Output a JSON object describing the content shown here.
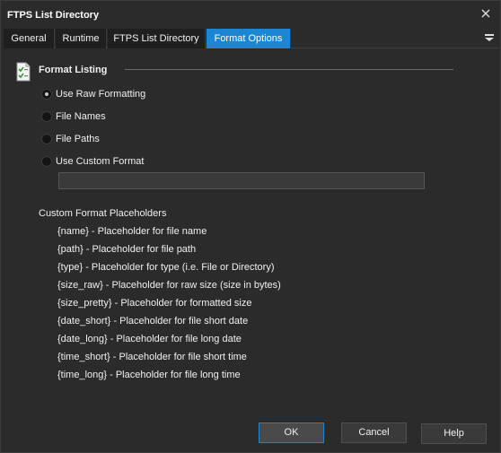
{
  "window": {
    "title": "FTPS List Directory"
  },
  "tabs": [
    {
      "label": "General"
    },
    {
      "label": "Runtime"
    },
    {
      "label": "FTPS List Directory"
    },
    {
      "label": "Format Options"
    }
  ],
  "section": {
    "title": "Format Listing"
  },
  "options": [
    {
      "label": "Use Raw Formatting",
      "checked": true
    },
    {
      "label": "File Names",
      "checked": false
    },
    {
      "label": "File Paths",
      "checked": false
    },
    {
      "label": "Use Custom Format",
      "checked": false
    }
  ],
  "custom_format": {
    "value": ""
  },
  "placeholders": {
    "title": "Custom Format Placeholders",
    "items": [
      "{name} - Placeholder for file name",
      "{path} - Placeholder for file path",
      "{type} - Placeholder for type (i.e. File or Directory)",
      "{size_raw} - Placeholder for raw size (size in bytes)",
      "{size_pretty} - Placeholder for formatted size",
      "{date_short} - Placeholder for file short date",
      "{date_long} - Placeholder for file long date",
      "{time_short} - Placeholder for file short time",
      "{time_long} - Placeholder for file long time"
    ]
  },
  "buttons": {
    "ok": "OK",
    "cancel": "Cancel",
    "help": "Help"
  },
  "colors": {
    "accent": "#1c86d2",
    "background": "#2b2b2b",
    "tab_bg": "#1f1f1f"
  },
  "icons": {
    "close": "close-icon",
    "menu": "menu-icon",
    "section": "checklist-document-icon"
  }
}
